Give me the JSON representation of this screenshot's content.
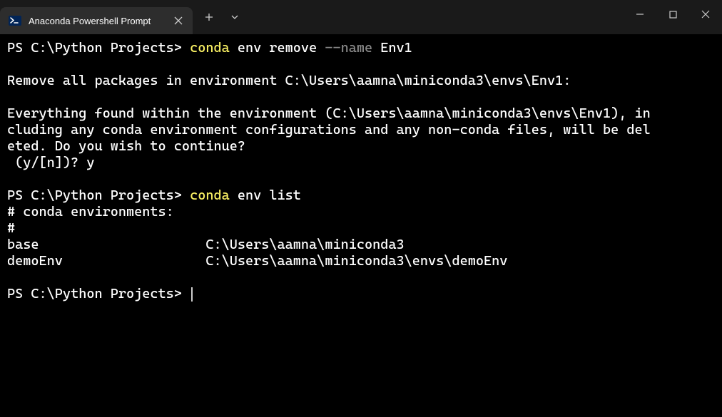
{
  "window": {
    "tab_title": "Anaconda Powershell Prompt"
  },
  "terminal": {
    "line1": {
      "prompt": "PS C:\\Python Projects> ",
      "cmd": "conda",
      "args1": " env remove ",
      "flag": "--name",
      "args2": " Env1"
    },
    "blank1": "",
    "line3": "Remove all packages in environment C:\\Users\\aamna\\miniconda3\\envs\\Env1:",
    "blank2": "",
    "line5": "Everything found within the environment (C:\\Users\\aamna\\miniconda3\\envs\\Env1), in",
    "line6": "cluding any conda environment configurations and any non-conda files, will be del",
    "line7": "eted. Do you wish to continue?",
    "line8": " (y/[n])? y",
    "blank3": "",
    "line10": {
      "prompt": "PS C:\\Python Projects> ",
      "cmd": "conda",
      "args": " env list"
    },
    "line11": "# conda environments:",
    "line12": "#",
    "line13": "base                     C:\\Users\\aamna\\miniconda3",
    "line14": "demoEnv                  C:\\Users\\aamna\\miniconda3\\envs\\demoEnv",
    "blank4": "",
    "line16": {
      "prompt": "PS C:\\Python Projects> "
    }
  }
}
